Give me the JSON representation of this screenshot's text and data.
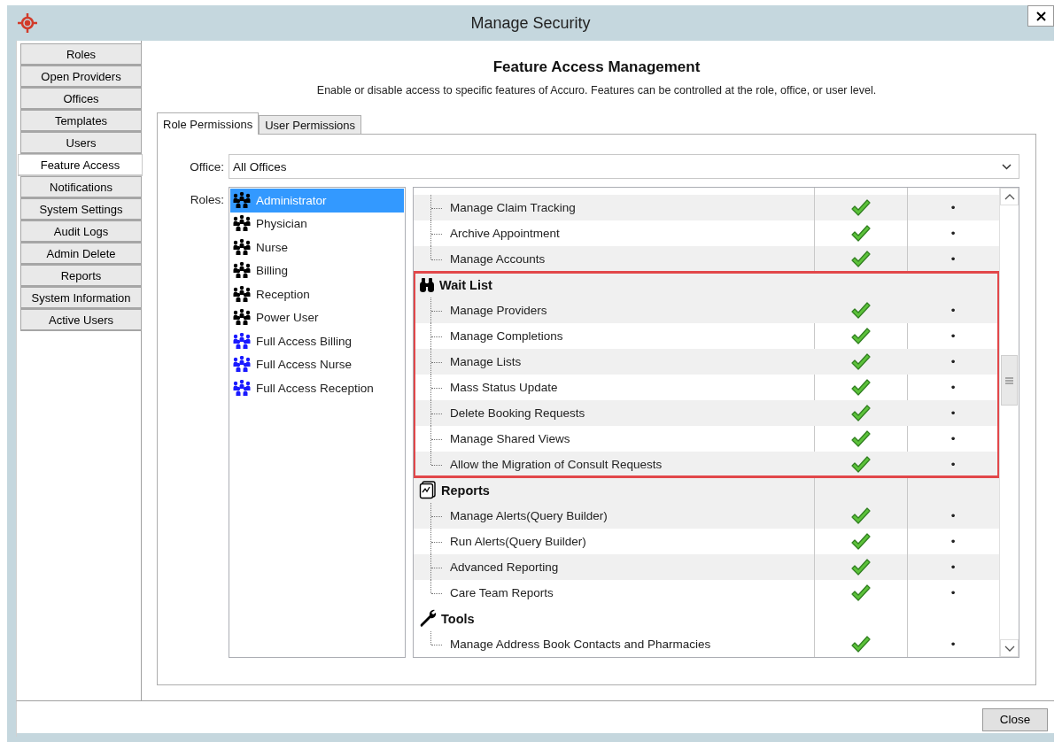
{
  "window": {
    "title": "Manage Security"
  },
  "sidebar": {
    "items": [
      {
        "label": "Roles",
        "selected": false
      },
      {
        "label": "Open Providers",
        "selected": false
      },
      {
        "label": "Offices",
        "selected": false
      },
      {
        "label": "Templates",
        "selected": false
      },
      {
        "label": "Users",
        "selected": false
      },
      {
        "label": "Feature Access",
        "selected": true
      },
      {
        "label": "Notifications",
        "selected": false
      },
      {
        "label": "System Settings",
        "selected": false
      },
      {
        "label": "Audit Logs",
        "selected": false
      },
      {
        "label": "Admin Delete",
        "selected": false
      },
      {
        "label": "Reports",
        "selected": false
      },
      {
        "label": "System Information",
        "selected": false
      },
      {
        "label": "Active Users",
        "selected": false
      }
    ]
  },
  "heading": "Feature Access Management",
  "subtitle": "Enable or disable access to specific features of Accuro. Features can be controlled at the role, office, or user level.",
  "tabs": [
    {
      "label": "Role Permissions",
      "selected": true
    },
    {
      "label": "User Permissions",
      "selected": false
    }
  ],
  "office": {
    "label": "Office:",
    "value": "All Offices"
  },
  "roles": {
    "label": "Roles:",
    "items": [
      {
        "name": "Administrator",
        "color": "#000000",
        "selected": true
      },
      {
        "name": "Physician",
        "color": "#000000",
        "selected": false
      },
      {
        "name": "Nurse",
        "color": "#000000",
        "selected": false
      },
      {
        "name": "Billing",
        "color": "#000000",
        "selected": false
      },
      {
        "name": "Reception",
        "color": "#000000",
        "selected": false
      },
      {
        "name": "Power User",
        "color": "#000000",
        "selected": false
      },
      {
        "name": "Full Access Billing",
        "color": "#1a1aff",
        "selected": false
      },
      {
        "name": "Full Access Nurse",
        "color": "#1a1aff",
        "selected": false
      },
      {
        "name": "Full Access Reception",
        "color": "#1a1aff",
        "selected": false
      }
    ]
  },
  "features": {
    "groups": [
      {
        "highlighted": false,
        "children": [
          {
            "label": "Manage Claim Tracking",
            "checked": true,
            "column_3": "•"
          },
          {
            "label": "Archive Appointment",
            "checked": true,
            "column_3": "•"
          },
          {
            "label": "Manage Accounts",
            "checked": true,
            "column_3": "•"
          }
        ]
      },
      {
        "label": "Wait List",
        "kind": "binoculars",
        "highlighted": true,
        "children": [
          {
            "label": "Manage Providers",
            "checked": true,
            "column_3": "•"
          },
          {
            "label": "Manage Completions",
            "checked": true,
            "column_3": "•"
          },
          {
            "label": "Manage Lists",
            "checked": true,
            "column_3": "•"
          },
          {
            "label": "Mass Status Update",
            "checked": true,
            "column_3": "•"
          },
          {
            "label": "Delete Booking Requests",
            "checked": true,
            "column_3": "•"
          },
          {
            "label": "Manage Shared Views",
            "checked": true,
            "column_3": "•"
          },
          {
            "label": "Allow the Migration of Consult Requests",
            "checked": true,
            "column_3": "•"
          }
        ]
      },
      {
        "label": "Reports",
        "kind": "report",
        "highlighted": false,
        "children": [
          {
            "label": "Manage Alerts(Query Builder)",
            "checked": true,
            "column_3": "•"
          },
          {
            "label": "Run Alerts(Query Builder)",
            "checked": true,
            "column_3": "•"
          },
          {
            "label": "Advanced Reporting",
            "checked": true,
            "column_3": "•"
          },
          {
            "label": "Care Team Reports",
            "checked": true,
            "column_3": "•"
          }
        ]
      },
      {
        "label": "Tools",
        "kind": "wrench",
        "highlighted": false,
        "children": [
          {
            "label": "Manage Address Book Contacts and Pharmacies",
            "checked": true,
            "column_3": "•"
          }
        ]
      }
    ]
  },
  "buttons": [
    {
      "label": "Close"
    }
  ]
}
